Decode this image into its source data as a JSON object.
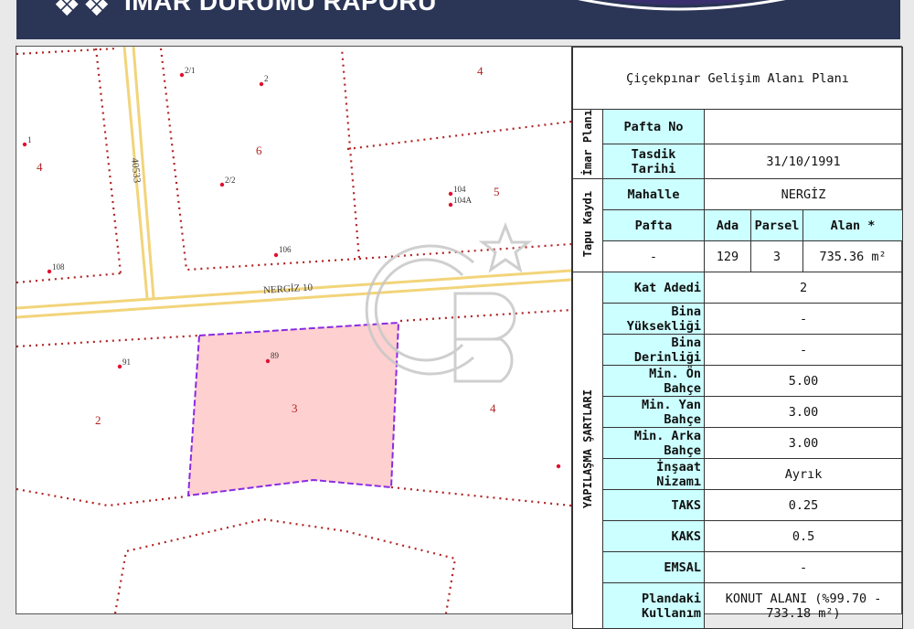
{
  "header": {
    "logo_glyph": "❖❖",
    "title": "İMAR DURUMU RAPORU"
  },
  "map": {
    "road_name": "NERGİZ 10",
    "road_number": "40533",
    "parcel_labels": [
      "4",
      "6",
      "4",
      "5",
      "2",
      "3",
      "4"
    ],
    "point_labels": [
      "2/1",
      "2",
      "1",
      "2/2",
      "104",
      "104A",
      "106",
      "108",
      "89",
      "91"
    ]
  },
  "panel": {
    "plan_title": "Çiçekpınar Gelişim Alanı Planı",
    "imar_plani_label": "İmar Planı",
    "pafta_no_label": "Pafta No",
    "pafta_no_value": "",
    "tasdik_label": "Tasdik Tarihi",
    "tasdik_value": "31/10/1991",
    "tapu_label": "Tapu Kaydı",
    "mahalle_label": "Mahalle",
    "mahalle_value": "NERGİZ",
    "pafta_label": "Pafta",
    "ada_label": "Ada",
    "parsel_label": "Parsel",
    "alan_label": "Alan *",
    "pafta_value": "-",
    "ada_value": "129",
    "parsel_value": "3",
    "alan_value": "735.36 m²",
    "yapilasma_label": "YAPILAŞMA ŞARTLARI",
    "conditions": [
      {
        "label": "Kat Adedi",
        "value": "2"
      },
      {
        "label": "Bina Yüksekliği",
        "value": "-"
      },
      {
        "label": "Bina Derinliği",
        "value": "-"
      },
      {
        "label": "Min. Ön Bahçe",
        "value": "5.00"
      },
      {
        "label": "Min. Yan Bahçe",
        "value": "3.00"
      },
      {
        "label": "Min. Arka Bahçe",
        "value": "3.00"
      },
      {
        "label": "İnşaat Nizamı",
        "value": "Ayrık"
      },
      {
        "label": "TAKS",
        "value": "0.25"
      },
      {
        "label": "KAKS",
        "value": "0.5"
      },
      {
        "label": "EMSAL",
        "value": "-"
      },
      {
        "label": "Plandaki Kullanım",
        "value": "KONUT ALANI  (%99.70 - 733.18 m²)"
      }
    ]
  },
  "colors": {
    "header_bg": "#2b3556",
    "boundary": "#b22222",
    "road": "#f2d47a",
    "parcel_fill": "#ffd0d0",
    "parcel_edge": "#8a2be2",
    "cell_label_bg": "#ccffff"
  }
}
